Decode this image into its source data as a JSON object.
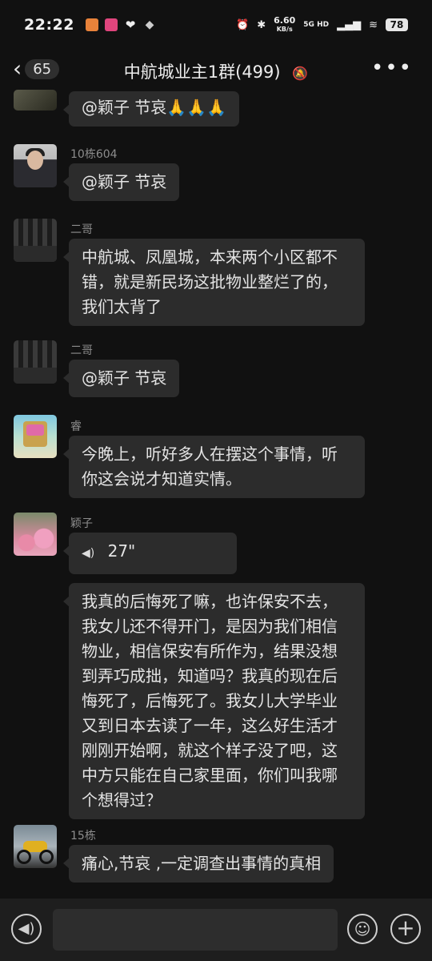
{
  "status_bar": {
    "time": "22:22",
    "net_speed": "6.60",
    "net_unit": "KB/s",
    "signal": "5G HD",
    "battery": "78"
  },
  "header": {
    "back_count": "65",
    "title": "中航城业主1群(499)"
  },
  "messages": [
    {
      "sender": "",
      "type": "text",
      "text": "@颖子  节哀🙏🙏🙏"
    },
    {
      "sender": "10栋604",
      "type": "text",
      "text": "@颖子  节哀"
    },
    {
      "sender": "二哥",
      "type": "text",
      "text": "中航城、凤凰城，本来两个小区都不错，就是新民场这批物业整烂了的，我们太背了"
    },
    {
      "sender": "二哥",
      "type": "text",
      "text": "@颖子  节哀"
    },
    {
      "sender": "睿",
      "type": "text",
      "text": "今晚上，听好多人在摆这个事情，听你这会说才知道实情。"
    },
    {
      "sender": "颖子",
      "type": "voice",
      "text": "27\""
    },
    {
      "sender": "",
      "type": "text",
      "text": "我真的后悔死了嘛，也许保安不去，我女儿还不得开门，是因为我们相信物业，相信保安有所作为，结果没想到弄巧成拙，知道吗？我真的现在后悔死了，后悔死了。我女儿大学毕业又到日本去读了一年，这么好生活才刚刚开始啊，就这个样子没了吧，这中方只能在自己家里面，你们叫我哪个想得过？"
    },
    {
      "sender": "15栋",
      "type": "text",
      "text": "痛心,节哀 ,一定调查出事情的真相"
    }
  ],
  "input": {
    "placeholder": ""
  },
  "icons": {
    "back": "chevron-left-icon",
    "mute": "bell-off-icon",
    "more": "more-icon",
    "voice": "voice-icon",
    "emoji": "emoji-icon",
    "plus": "plus-icon"
  }
}
